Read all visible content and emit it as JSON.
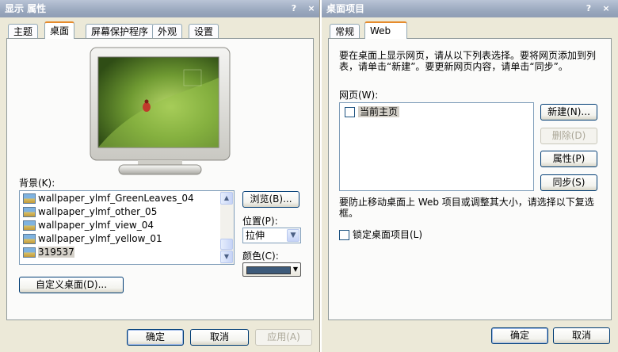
{
  "left_dialog": {
    "title": "显示 属性",
    "help_glyph": "?",
    "close_glyph": "×",
    "tabs": [
      "主题",
      "桌面",
      "屏幕保护程序",
      "外观",
      "设置"
    ],
    "background_label": "背景(K):",
    "wallpapers": [
      "wallpaper_ylmf_GreenLeaves_04",
      "wallpaper_ylmf_other_05",
      "wallpaper_ylmf_view_04",
      "wallpaper_ylmf_yellow_01",
      "319537"
    ],
    "browse_label": "浏览(B)...",
    "position_label": "位置(P):",
    "position_value": "拉伸",
    "color_label": "颜色(C):",
    "color_value": "#3d5a7a",
    "customize_label": "自定义桌面(D)...",
    "ok_label": "确定",
    "cancel_label": "取消",
    "apply_label": "应用(A)"
  },
  "right_dialog": {
    "title": "桌面项目",
    "help_glyph": "?",
    "close_glyph": "×",
    "tabs": [
      "常规",
      "Web"
    ],
    "instructions": "要在桌面上显示网页，请从以下列表选择。要将网页添加到列表，请单击“新建”。要更新网页内容，请单击“同步”。",
    "webpages_label": "网页(W):",
    "webpage_items": [
      "当前主页"
    ],
    "new_label": "新建(N)...",
    "delete_label": "删除(D)",
    "properties_label": "属性(P)",
    "sync_label": "同步(S)",
    "lock_note": "要防止移动桌面上 Web 项目或调整其大小，请选择以下复选框。",
    "lock_label": "锁定桌面项目(L)",
    "ok_label": "确定",
    "cancel_label": "取消"
  }
}
